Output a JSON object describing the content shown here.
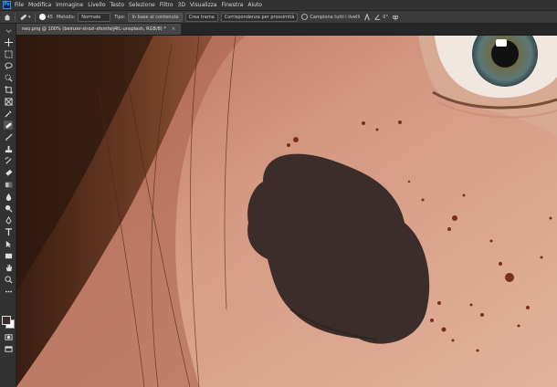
{
  "app": {
    "logo_text": "Ps"
  },
  "menu": [
    "File",
    "Modifica",
    "Immagine",
    "Livello",
    "Testo",
    "Selezione",
    "Filtro",
    "3D",
    "Visualizza",
    "Finestra",
    "Aiuto"
  ],
  "options_bar": {
    "brush_size": "45",
    "mode_label": "Metodo:",
    "mode_value": "Normale",
    "type_label": "Tipo:",
    "btn_content_aware": "In base al contenuto",
    "btn_create_texture": "Crea trama",
    "btn_proximity": "Corrispondenza per prossimità",
    "sample_all_layers": "Campiona tutti i livelli",
    "angle_value": "0°"
  },
  "document_tab": {
    "title": "neo.png @ 100% (beinzer-sirozi-xfsmfalj4tL-unsplash, RGB/8) *"
  },
  "colors": {
    "foreground": "#3b2e2a",
    "background": "#ffffff",
    "accent": "#2e8ef2"
  }
}
